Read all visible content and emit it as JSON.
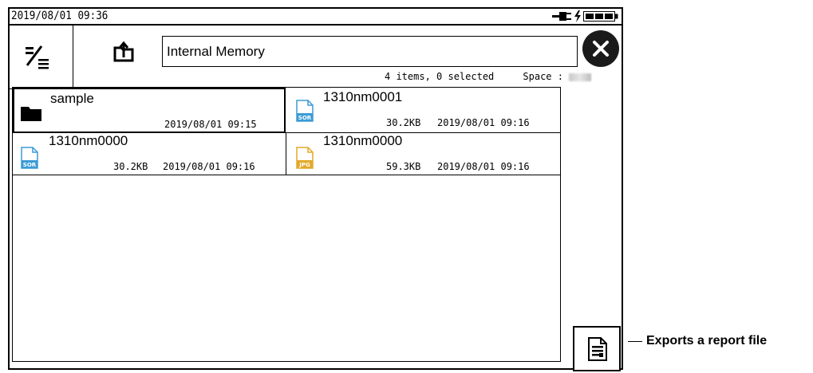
{
  "status": {
    "datetime": "2019/08/01  09:36",
    "icons": [
      "plug-icon",
      "bolt-icon",
      "battery-icon"
    ]
  },
  "toolbar": {
    "filter_icon": "filter-list-icon",
    "export_icon": "folder-export-icon",
    "path": "Internal Memory",
    "close_icon": "close-icon"
  },
  "info": {
    "summary": "4 items, 0 selected",
    "space_label": "Space :"
  },
  "files": [
    {
      "name": "sample",
      "type": "folder",
      "size": "",
      "date": "2019/08/01 09:15",
      "selected": true
    },
    {
      "name": "1310nm0001",
      "type": "SOR",
      "size": "30.2KB",
      "date": "2019/08/01 09:16",
      "selected": false
    },
    {
      "name": "1310nm0000",
      "type": "SOR",
      "size": "30.2KB",
      "date": "2019/08/01 09:16",
      "selected": false
    },
    {
      "name": "1310nm0000",
      "type": "JPG",
      "size": "59.3KB",
      "date": "2019/08/01 09:16",
      "selected": false
    }
  ],
  "colors": {
    "sor_icon": "#3b9bd5",
    "jpg_icon": "#e3a92a"
  },
  "report": {
    "icon": "report-file-icon",
    "callout": "Exports a report file"
  }
}
